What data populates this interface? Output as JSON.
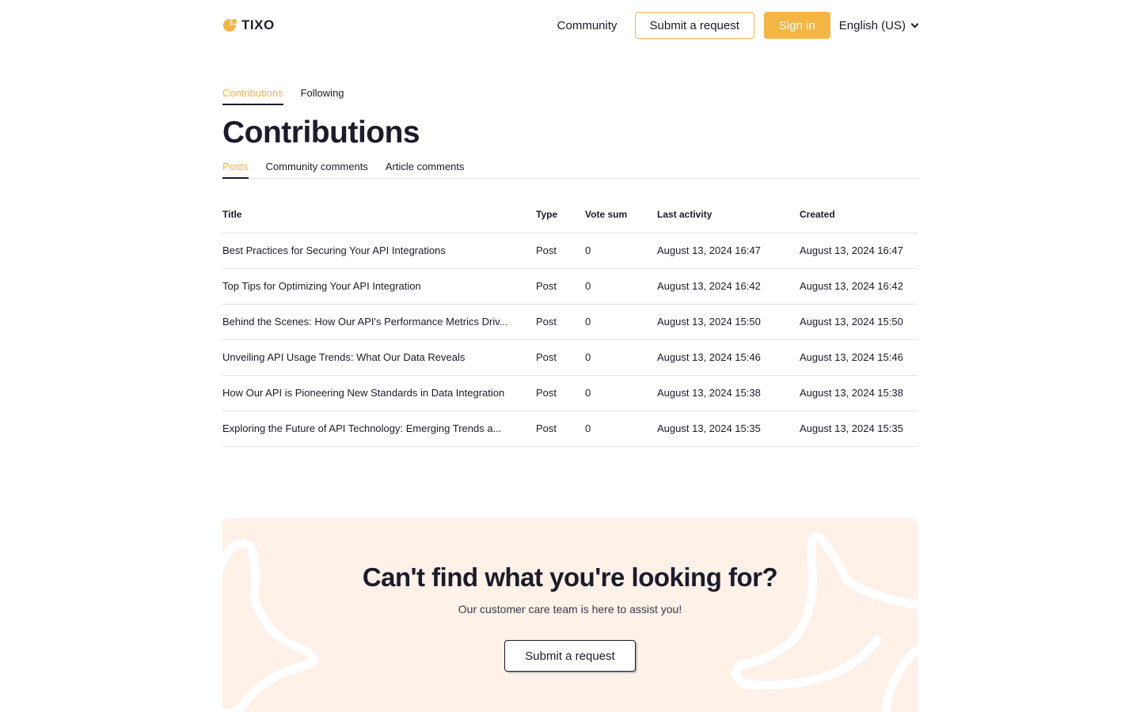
{
  "header": {
    "logo_text": "TIXO",
    "nav_community": "Community",
    "submit_request": "Submit a request",
    "sign_in": "Sign in",
    "language": "English (US)"
  },
  "top_tabs": [
    {
      "label": "Contributions",
      "active": true
    },
    {
      "label": "Following",
      "active": false
    }
  ],
  "page_title": "Contributions",
  "sub_tabs": [
    {
      "label": "Posts",
      "active": true
    },
    {
      "label": "Community comments",
      "active": false
    },
    {
      "label": "Article comments",
      "active": false
    }
  ],
  "table": {
    "columns": [
      "Title",
      "Type",
      "Vote sum",
      "Last activity",
      "Created"
    ],
    "rows": [
      {
        "title": "Best Practices for Securing Your API Integrations",
        "type": "Post",
        "votes": "0",
        "last": "August 13, 2024 16:47",
        "created": "August 13, 2024 16:47"
      },
      {
        "title": "Top Tips for Optimizing Your API Integration",
        "type": "Post",
        "votes": "0",
        "last": "August 13, 2024 16:42",
        "created": "August 13, 2024 16:42"
      },
      {
        "title": "Behind the Scenes: How Our API's Performance Metrics Driv...",
        "type": "Post",
        "votes": "0",
        "last": "August 13, 2024 15:50",
        "created": "August 13, 2024 15:50"
      },
      {
        "title": "Unveiling API Usage Trends: What Our Data Reveals",
        "type": "Post",
        "votes": "0",
        "last": "August 13, 2024 15:46",
        "created": "August 13, 2024 15:46"
      },
      {
        "title": "How Our API is Pioneering New Standards in Data Integration",
        "type": "Post",
        "votes": "0",
        "last": "August 13, 2024 15:38",
        "created": "August 13, 2024 15:38"
      },
      {
        "title": "Exploring the Future of API Technology: Emerging Trends a...",
        "type": "Post",
        "votes": "0",
        "last": "August 13, 2024 15:35",
        "created": "August 13, 2024 15:35"
      }
    ]
  },
  "cta": {
    "title": "Can't find what you're looking for?",
    "subtitle": "Our customer care team is here to assist you!",
    "button": "Submit a request"
  },
  "colors": {
    "accent": "#f5b544",
    "text": "#1b1b2a",
    "cta_bg": "#fdf1e8"
  }
}
